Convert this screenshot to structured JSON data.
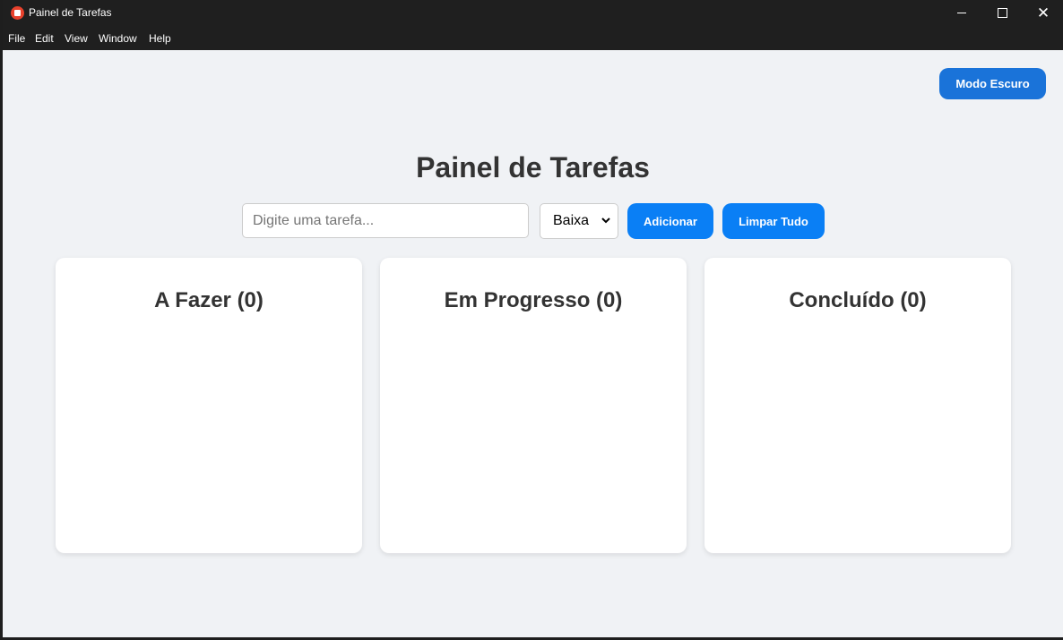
{
  "window": {
    "title": "Painel de Tarefas",
    "close_glyph": "✕"
  },
  "menu": [
    "File",
    "Edit",
    "View",
    "Window",
    "Help"
  ],
  "header": {
    "dark_mode_label": "Modo Escuro",
    "page_title": "Painel de Tarefas"
  },
  "form": {
    "task_placeholder": "Digite uma tarefa...",
    "task_value": "",
    "priority_selected": "Baixa",
    "add_label": "Adicionar",
    "clear_label": "Limpar Tudo"
  },
  "columns": [
    {
      "title": "A Fazer (0)"
    },
    {
      "title": "Em Progresso (0)"
    },
    {
      "title": "Concluído (0)"
    }
  ],
  "colors": {
    "accent_button": "#0a7ff5",
    "dark_mode_button": "#1a73d9",
    "background": "#f0f2f5",
    "titlebar": "#1f1f1f"
  },
  "icons": [
    "app-icon",
    "minimize-icon",
    "maximize-icon",
    "close-icon",
    "chevron-down-icon"
  ]
}
